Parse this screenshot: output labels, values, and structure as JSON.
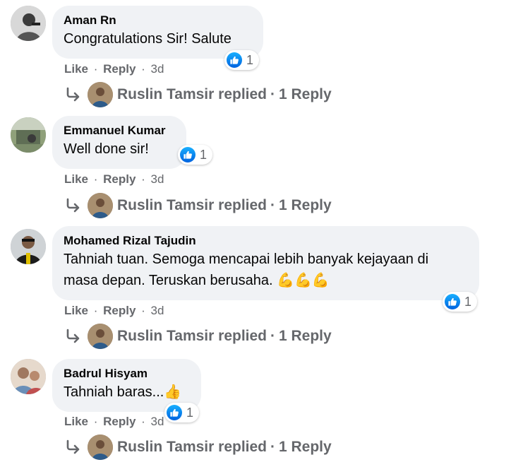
{
  "comments": [
    {
      "author": "Aman Rn",
      "text": "Congratulations Sir! Salute",
      "emoji": "",
      "reaction_count": "1",
      "like_label": "Like",
      "reply_label": "Reply",
      "time": "3d",
      "reply_author": "Ruslin Tamsir replied",
      "reply_count": "1 Reply"
    },
    {
      "author": "Emmanuel Kumar",
      "text": "Well done sir!",
      "emoji": "",
      "reaction_count": "1",
      "like_label": "Like",
      "reply_label": "Reply",
      "time": "3d",
      "reply_author": "Ruslin Tamsir replied",
      "reply_count": "1 Reply"
    },
    {
      "author": "Mohamed Rizal Tajudin",
      "text_line1": "Tahniah tuan. Semoga mencapai lebih banyak kejayaan di",
      "text_line2": "masa depan. Teruskan berusaha.",
      "emoji": "💪💪💪",
      "reaction_count": "1",
      "like_label": "Like",
      "reply_label": "Reply",
      "time": "3d",
      "reply_author": "Ruslin Tamsir replied",
      "reply_count": "1 Reply"
    },
    {
      "author": "Badrul Hisyam",
      "text": "Tahniah baras...",
      "emoji": "👍",
      "reaction_count": "1",
      "like_label": "Like",
      "reply_label": "Reply",
      "time": "3d",
      "reply_author": "Ruslin Tamsir replied",
      "reply_count": "1 Reply"
    }
  ],
  "colors": {
    "bubble": "#f0f2f5",
    "secondary_text": "#65676b",
    "like_blue": "#0866ff"
  },
  "icons": [
    "like-icon",
    "reply-arrow-icon"
  ]
}
